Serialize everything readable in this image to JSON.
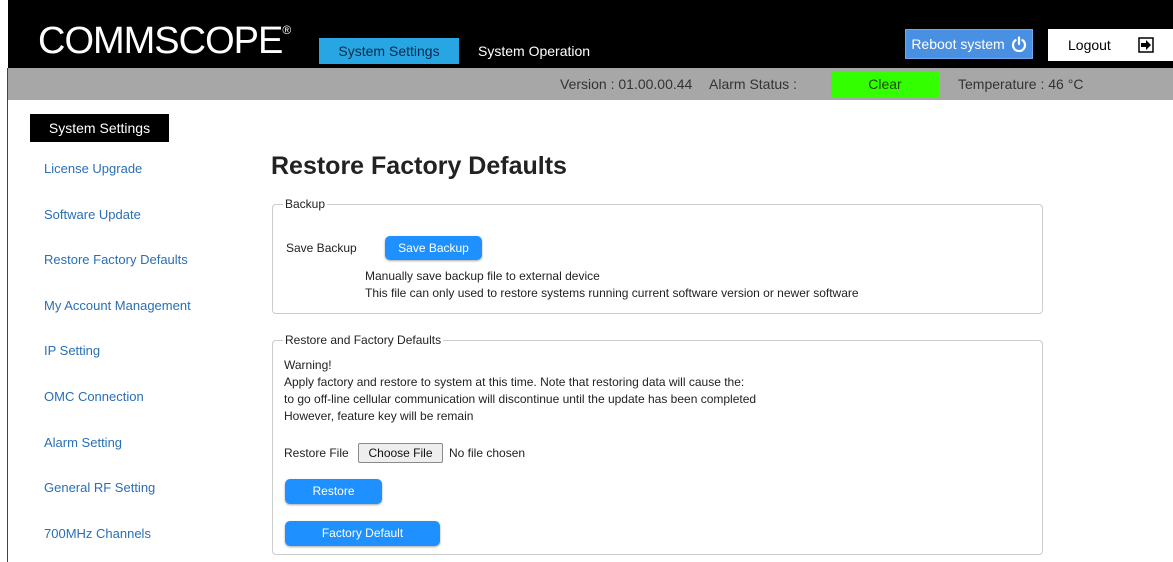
{
  "header": {
    "logo_text": "COMMSCOPE",
    "logo_mark": "®",
    "tabs": [
      {
        "label": "System Settings",
        "active": true
      },
      {
        "label": "System Operation",
        "active": false
      }
    ],
    "reboot_label": "Reboot system",
    "logout_label": "Logout"
  },
  "status": {
    "version": "Version : 01.00.00.44",
    "alarm_label": "Alarm Status :",
    "alarm_value": "Clear",
    "temperature": "Temperature : 46 °C"
  },
  "sidebar": {
    "title": "System Settings",
    "items": [
      "License Upgrade",
      "Software Update",
      "Restore Factory Defaults",
      "My Account Management",
      "IP Setting",
      "OMC Connection",
      "Alarm Setting",
      "General RF Setting",
      "700MHz Channels"
    ]
  },
  "main": {
    "title": "Restore Factory Defaults",
    "backup": {
      "legend": "Backup",
      "label": "Save Backup",
      "button": "Save Backup",
      "note1": "Manually save backup file to external device",
      "note2": "This file can only used to restore systems running current software version or newer software"
    },
    "restore": {
      "legend": "Restore and Factory Defaults",
      "warning": "Warning!",
      "line1": "Apply factory and restore to system at this time. Note that restoring data will cause the:",
      "line2": "to go off-line cellular communication will discontinue until the update has been completed",
      "line3": "However, feature key will be remain",
      "file_label": "Restore File",
      "choose_file": "Choose File",
      "no_file": "No file chosen",
      "restore_button": "Restore",
      "factory_button": "Factory Default"
    }
  },
  "colors": {
    "active_tab": "#27a6e3",
    "alarm_clear": "#33ff00",
    "button_blue": "#1e90ff",
    "link": "#2a6fb5"
  }
}
